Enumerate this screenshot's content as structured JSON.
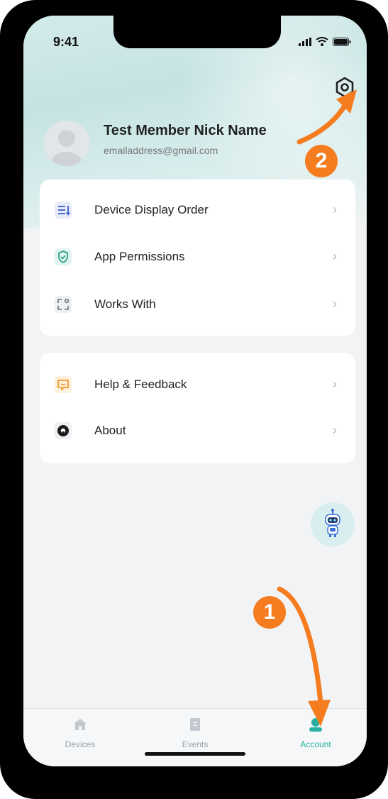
{
  "status_bar": {
    "time": "9:41"
  },
  "profile": {
    "name": "Test Member Nick Name",
    "email": "emailaddress@gmail.com"
  },
  "menu_group_1": [
    {
      "label": "Device Display Order",
      "icon": "sort-list-icon"
    },
    {
      "label": "App Permissions",
      "icon": "shield-check-icon"
    },
    {
      "label": "Works With",
      "icon": "works-with-icon"
    }
  ],
  "menu_group_2": [
    {
      "label": "Help & Feedback",
      "icon": "chat-feedback-icon"
    },
    {
      "label": "About",
      "icon": "about-logo-icon"
    }
  ],
  "chevron": "›",
  "tabs": [
    {
      "label": "Devices",
      "icon": "home-icon",
      "active": false
    },
    {
      "label": "Events",
      "icon": "events-icon",
      "active": false
    },
    {
      "label": "Account",
      "icon": "account-icon",
      "active": true
    }
  ],
  "annotations": {
    "step1": "1",
    "step2": "2"
  },
  "colors": {
    "accent": "#27b0a2",
    "annotation": "#f57c1f"
  }
}
